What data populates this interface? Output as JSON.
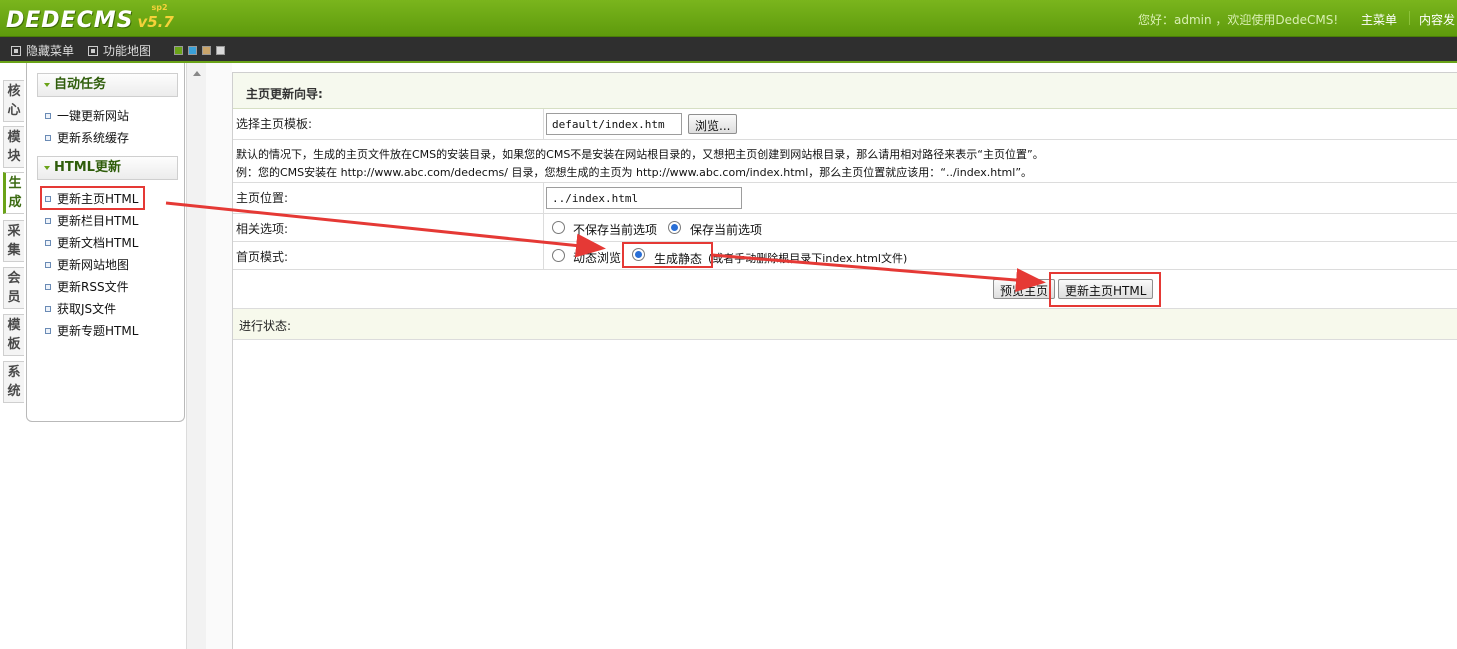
{
  "header": {
    "logo_text": "DEDECMS",
    "logo_version": "v5.7",
    "logo_version_sup": "sp2",
    "welcome": "您好：admin ，欢迎使用DedeCMS!",
    "nav": [
      "主菜单",
      "内容发"
    ]
  },
  "subbar": {
    "hide_menu": "隐藏菜单",
    "func_map": "功能地图",
    "skin_colors": [
      "#6aa318",
      "#3aa0d8",
      "#c9a46a",
      "#d9d9d9"
    ]
  },
  "vtabs": [
    "核心",
    "模块",
    "生成",
    "采集",
    "会员",
    "模板",
    "系统"
  ],
  "vtab_active_index": 2,
  "menu": {
    "group1": {
      "title": "自动任务",
      "items": [
        "一键更新网站",
        "更新系统缓存"
      ]
    },
    "group2": {
      "title": "HTML更新",
      "items": [
        "更新主页HTML",
        "更新栏目HTML",
        "更新文档HTML",
        "更新网站地图",
        "更新RSS文件",
        "获取JS文件",
        "更新专题HTML"
      ]
    }
  },
  "main": {
    "title": "主页更新向导:",
    "template_label": "选择主页模板:",
    "template_value": "default/index.htm",
    "browse_button": "浏览...",
    "note_line1": "默认的情况下，生成的主页文件放在CMS的安装目录，如果您的CMS不是安装在网站根目录的，又想把主页创建到网站根目录，那么请用相对路径来表示“主页位置”。",
    "note_line2": "例：您的CMS安装在 http://www.abc.com/dedecms/ 目录，您想生成的主页为 http://www.abc.com/index.html，那么主页位置就应该用：“../index.html”。",
    "position_label": "主页位置:",
    "position_value": "../index.html",
    "options_label": "相关选项:",
    "option_nosave": "不保存当前选项",
    "option_save": "保存当前选项",
    "mode_label": "首页模式:",
    "mode_dynamic": "动态浏览",
    "mode_static": "生成静态",
    "mode_hint": "(或者手动删除根目录下index.html文件)",
    "preview_button": "预览主页",
    "update_button": "更新主页HTML",
    "status_label": "进行状态:"
  },
  "annotation_color": "#e53935"
}
